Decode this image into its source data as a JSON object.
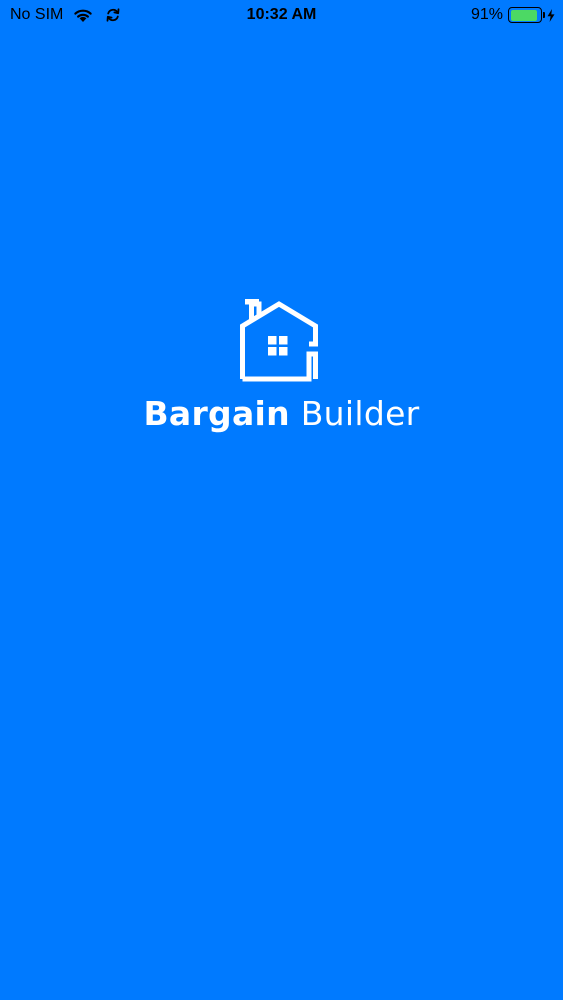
{
  "status_bar": {
    "carrier": "No SIM",
    "time": "10:32 AM",
    "battery_percent_label": "91%",
    "battery_level": 0.91,
    "icons": [
      "wifi-icon",
      "sync-icon",
      "battery-icon",
      "charging-bolt-icon"
    ],
    "battery_fill_color": "#4cd964"
  },
  "splash": {
    "brand_word_1": "Bargain",
    "brand_word_2": "Builder",
    "logo_icon": "house-logo-icon"
  },
  "colors": {
    "background": "#007aff",
    "logo": "#ffffff",
    "status_text": "#000000"
  }
}
